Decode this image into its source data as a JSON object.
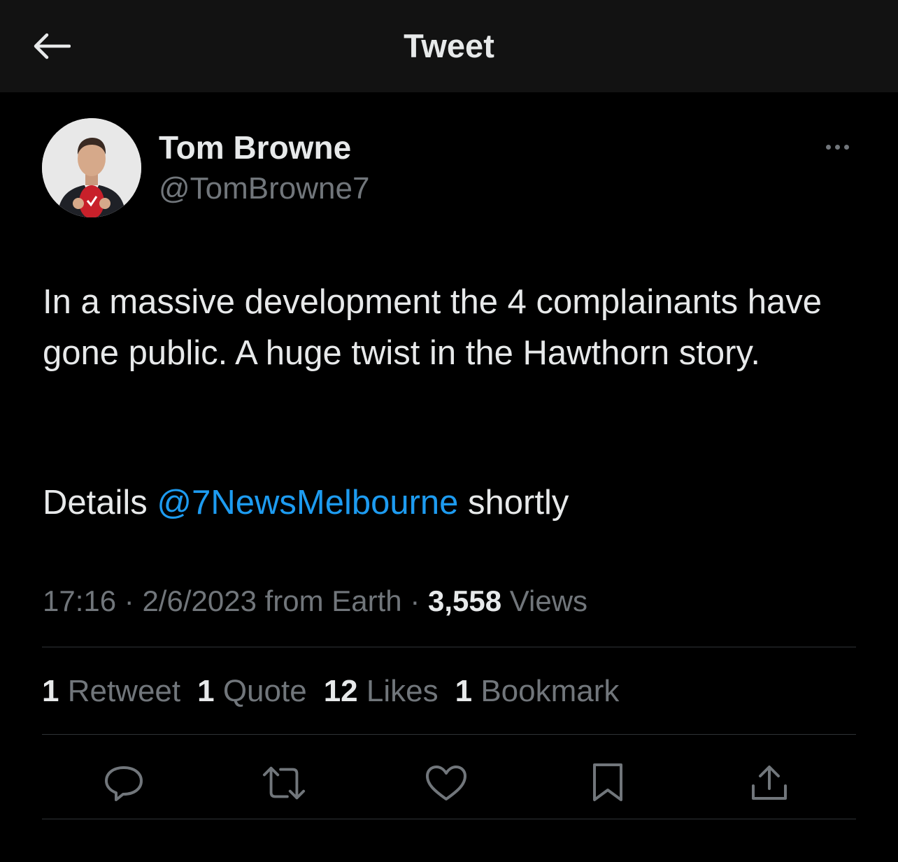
{
  "header": {
    "title": "Tweet",
    "back_icon": "arrow-left-icon"
  },
  "author": {
    "display_name": "Tom Browne",
    "handle": "@TomBrowne7",
    "more_icon": "more-horizontal-icon"
  },
  "tweet": {
    "text_line1": "In a massive development the 4 complainants have gone public. A huge twist in the Hawthorn story.",
    "text_prefix": "Details ",
    "mention": "@7NewsMelbourne",
    "text_suffix": " shortly"
  },
  "meta": {
    "time": "17:16",
    "separator1": " · ",
    "date": "2/6/2023",
    "source": " from Earth",
    "separator2": " · ",
    "views_count": "3,558",
    "views_label": " Views"
  },
  "stats": [
    {
      "count": "1",
      "label": " Retweet"
    },
    {
      "count": "1",
      "label": " Quote"
    },
    {
      "count": "12",
      "label": " Likes"
    },
    {
      "count": "1",
      "label": " Bookmark"
    }
  ],
  "actions": [
    {
      "name": "reply-icon"
    },
    {
      "name": "retweet-icon"
    },
    {
      "name": "like-icon"
    },
    {
      "name": "bookmark-icon"
    },
    {
      "name": "share-icon"
    }
  ],
  "colors": {
    "background": "#000000",
    "header_bg": "#121212",
    "text_primary": "#e7e9ea",
    "text_secondary": "#71767b",
    "link": "#1d9bf0",
    "divider": "#2f3336"
  }
}
